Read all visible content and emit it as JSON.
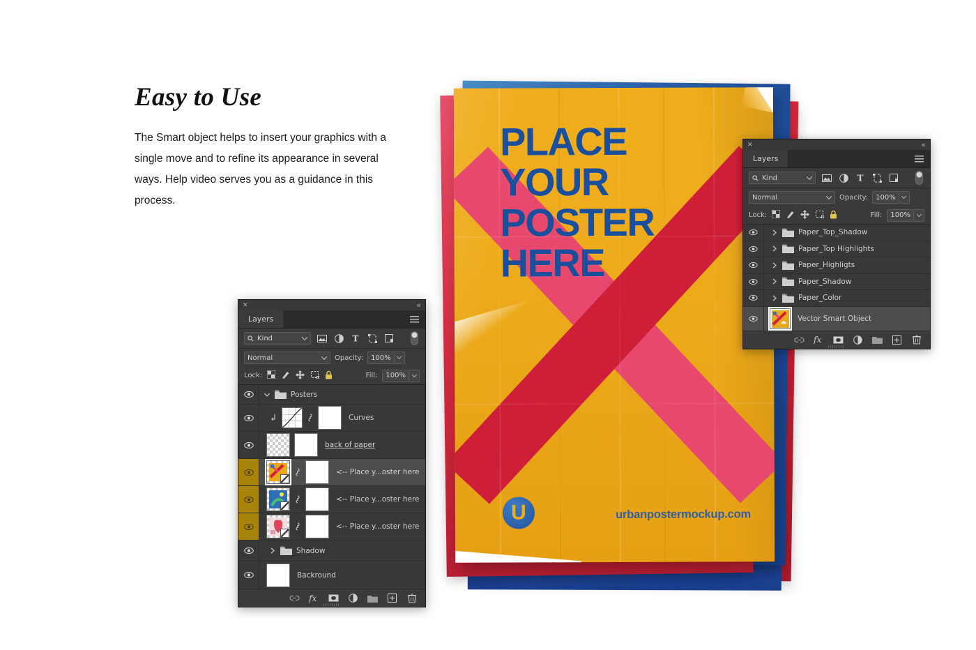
{
  "marketing": {
    "heading": "Easy to Use",
    "body": "The Smart object helps to insert your graphics with a single move and to refine its appearance in several ways. Help video serves you as a guidance in this process."
  },
  "poster": {
    "headline_lines": [
      "PLACE",
      "YOUR",
      "POSTER",
      "HERE"
    ],
    "logo_letter": "U",
    "url": "urbanpostermockup.com",
    "colors": {
      "paper_yellow": "#eeac1c",
      "headline_blue": "#1b4f9c",
      "x_pink": "#e8486d",
      "x_crimson": "#cf1f38",
      "sheet_blue": "#2f67b0",
      "sheet_red": "#d32a3f"
    }
  },
  "panels": {
    "main": {
      "close_label": "✕",
      "collapse_label": "«",
      "tab_label": "Layers",
      "menu_label": "☰",
      "filter": {
        "kind_label": "Kind",
        "search_icon": "search-icon",
        "chevron": "⌄",
        "icons": [
          "pixel-filter-icon",
          "adjustment-filter-icon",
          "type-filter-icon",
          "shape-filter-icon",
          "smart-object-filter-icon"
        ],
        "toggle_name": "filter-toggle"
      },
      "blend": {
        "mode": "Normal",
        "chevron": "⌄",
        "opacity_label": "Opacity:",
        "opacity_value": "100%"
      },
      "lock": {
        "label": "Lock:",
        "icons": [
          "lock-transparent-pixels-icon",
          "lock-image-pixels-icon",
          "lock-position-icon",
          "lock-artboard-icon",
          "lock-all-icon"
        ],
        "fill_label": "Fill:",
        "fill_value": "100%"
      },
      "rows": [
        {
          "name": "Posters",
          "type": "group",
          "expanded": true,
          "visible": true,
          "selected": false,
          "gold": false
        },
        {
          "name": "Curves",
          "type": "adjustment",
          "clipped": true,
          "visible": true,
          "selected": false,
          "gold": false
        },
        {
          "name": "back of paper",
          "type": "pixel",
          "underline": true,
          "visible": true,
          "selected": false,
          "gold": false
        },
        {
          "name": "<-- Place y...oster here",
          "type": "smart-object",
          "visible": true,
          "selected": true,
          "gold": true,
          "art": "yellow"
        },
        {
          "name": "<-- Place y...oster here",
          "type": "smart-object",
          "visible": true,
          "selected": false,
          "gold": true,
          "art": "blue"
        },
        {
          "name": "<-- Place y...oster here",
          "type": "smart-object",
          "visible": true,
          "selected": false,
          "gold": true,
          "art": "pink"
        },
        {
          "name": "Shadow",
          "type": "group",
          "expanded": false,
          "visible": true,
          "selected": false,
          "gold": false
        },
        {
          "name": "Backround",
          "type": "pixel",
          "visible": true,
          "selected": false,
          "gold": false,
          "solid": "#ffffff"
        }
      ],
      "footer_icons": [
        "link-layers-icon",
        "layer-style-fx-icon",
        "add-layer-mask-icon",
        "new-adjustment-layer-icon",
        "new-group-icon",
        "new-layer-icon",
        "delete-layer-icon"
      ]
    },
    "secondary": {
      "close_label": "✕",
      "collapse_label": "«",
      "tab_label": "Layers",
      "menu_label": "☰",
      "filter": {
        "kind_label": "Kind",
        "chevron": "⌄"
      },
      "blend": {
        "mode": "Normal",
        "chevron": "⌄",
        "opacity_label": "Opacity:",
        "opacity_value": "100%"
      },
      "lock": {
        "label": "Lock:",
        "fill_label": "Fill:",
        "fill_value": "100%"
      },
      "rows": [
        {
          "name": "Paper_Top_Shadow",
          "type": "group",
          "expanded": false,
          "visible": true,
          "selected": false
        },
        {
          "name": "Paper_Top Highlights",
          "type": "group",
          "expanded": false,
          "visible": true,
          "selected": false
        },
        {
          "name": "Paper_Highligts",
          "type": "group",
          "expanded": false,
          "visible": true,
          "selected": false
        },
        {
          "name": "Paper_Shadow",
          "type": "group",
          "expanded": false,
          "visible": true,
          "selected": false
        },
        {
          "name": "Paper_Color",
          "type": "group",
          "expanded": false,
          "visible": true,
          "selected": false
        },
        {
          "name": "Vector Smart Object",
          "type": "smart-object",
          "visible": true,
          "selected": true,
          "art": "yellow"
        }
      ],
      "footer_icons": [
        "link-layers-icon",
        "layer-style-fx-icon",
        "add-layer-mask-icon",
        "new-adjustment-layer-icon",
        "new-group-icon",
        "new-layer-icon",
        "delete-layer-icon"
      ]
    }
  }
}
